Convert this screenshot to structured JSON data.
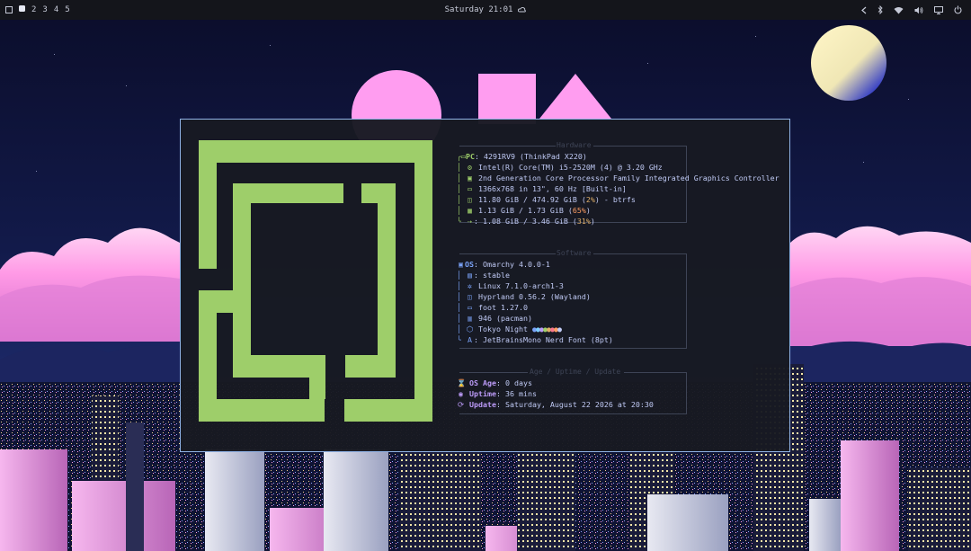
{
  "topbar": {
    "workspaces": [
      "1",
      "2",
      "3",
      "4",
      "5"
    ],
    "active_workspace": "1",
    "clock": "Saturday 21:01",
    "clock_icon": "weather-icon",
    "tray_icons": [
      "chevron-left-icon",
      "bluetooth-icon",
      "wifi-icon",
      "volume-icon",
      "monitor-icon",
      "power-icon"
    ]
  },
  "fastfetch": {
    "hardware": {
      "title": "Hardware",
      "pc_key": "PC",
      "pc_value": ": 4291RV9 (ThinkPad X220)",
      "cpu": "Intel(R) Core(TM) i5-2520M (4) @ 3.20 GHz",
      "gpu": "2nd Generation Core Processor Family Integrated Graphics Controller",
      "display": "1366x768 in 13\", 60 Hz [Built-in]",
      "disk_a": "11.80 GiB / 474.92 GiB (",
      "disk_pct": "2%",
      "disk_b": ") - btrfs",
      "memory_a": "1.13 GiB / 1.73 GiB (",
      "memory_pct": "65%",
      "memory_b": ")",
      "swap_a": ": 1.08 GiB / 3.46 GiB (",
      "swap_pct": "31%",
      "swap_b": ")"
    },
    "software": {
      "title": "Software",
      "os_key": "OS",
      "os_value": ": Omarchy 4.0.0-1",
      "channel": ": stable",
      "kernel": "Linux 7.1.0-arch1-3",
      "wm": "Hyprland 0.56.2 (Wayland)",
      "terminal": "foot 1.27.0",
      "packages": "946 (pacman)",
      "theme": "Tokyo Night",
      "font": "JetBrainsMono Nerd Font (8pt)"
    },
    "age": {
      "title": "Age / Uptime / Update",
      "os_age_key": "OS Age",
      "os_age_value": ": 0 days",
      "uptime_key": "Uptime",
      "uptime_value": ": 36 mins",
      "update_key": "Update",
      "update_value": ": Saturday, August 22 2026 at 20:30"
    },
    "palette": [
      "#7aa2f7",
      "#7dcfff",
      "#bb9af7",
      "#9ece6a",
      "#e0af68",
      "#f7768e",
      "#ff9e64",
      "#c0caf5"
    ]
  },
  "colors": {
    "logo": "#9ece6a",
    "border": "#8fb2e6",
    "accent_green": "#9ece6a",
    "accent_blue": "#7aa2f7"
  }
}
